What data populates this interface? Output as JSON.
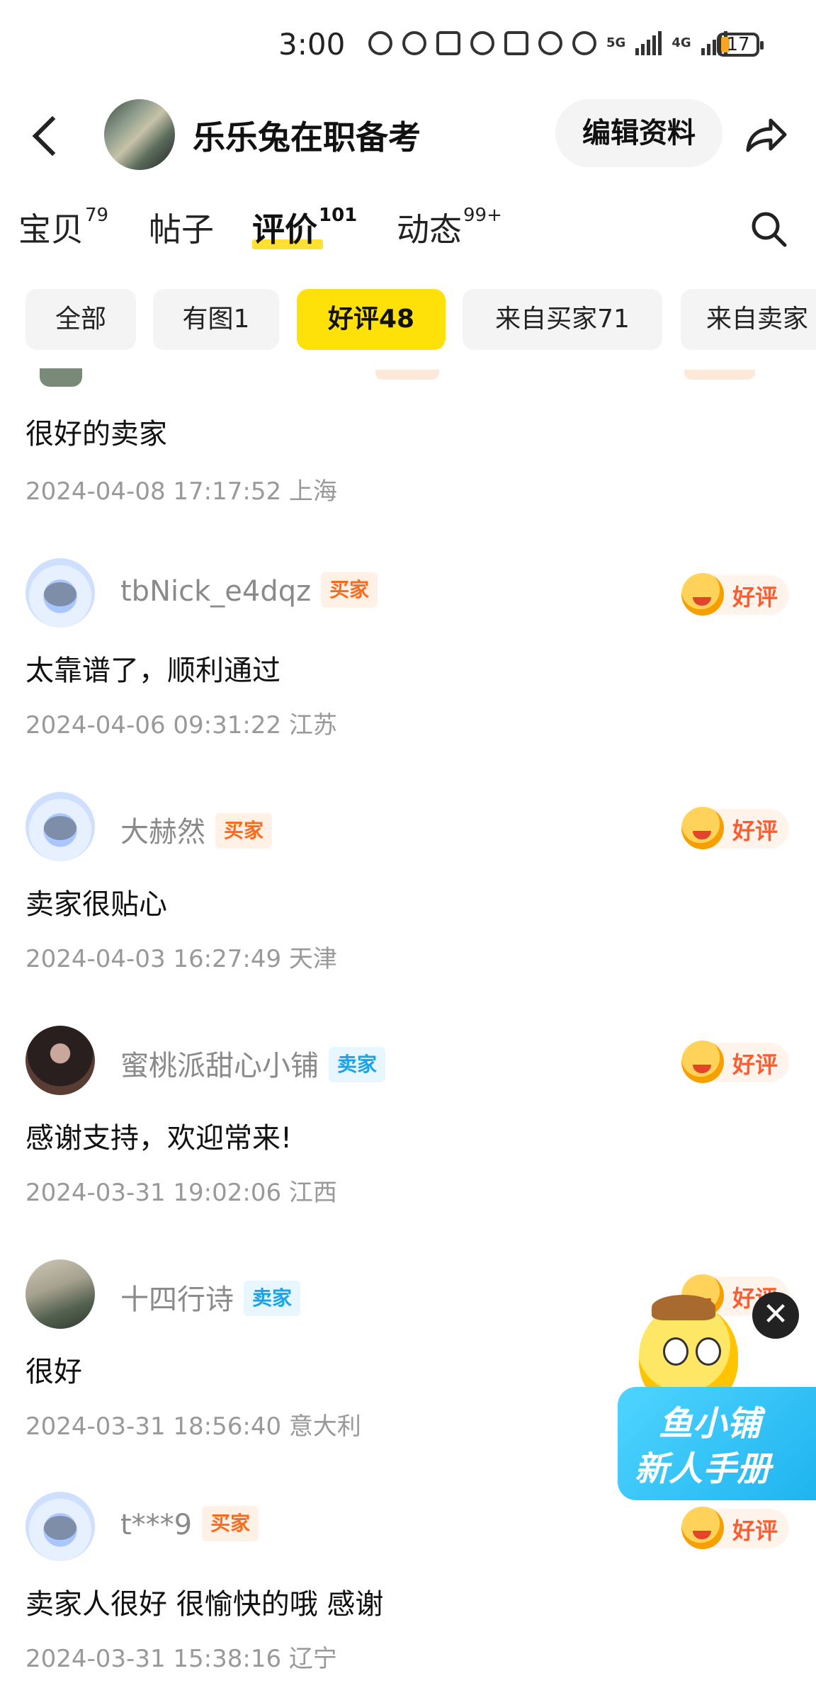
{
  "status_bar": {
    "time": "3:00",
    "network_5g": "5G",
    "network_4g": "4G",
    "battery": "17"
  },
  "header": {
    "shop_name": "乐乐兔在职备考",
    "edit_label": "编辑资料"
  },
  "tabs": [
    {
      "label": "宝贝",
      "count": "79"
    },
    {
      "label": "帖子",
      "count": ""
    },
    {
      "label": "评价",
      "count": "101"
    },
    {
      "label": "动态",
      "count": "99+"
    }
  ],
  "filters": [
    "全部",
    "有图1",
    "好评48",
    "来自买家71",
    "来自卖家"
  ],
  "top_partial_review": {
    "content": "很好的卖家",
    "meta": "2024-04-08 17:17:52 上海"
  },
  "reviews": [
    {
      "name": "tbNick_e4dqz",
      "role": "买家",
      "rating": "好评",
      "content": "太靠谱了，顺利通过",
      "meta": "2024-04-06 09:31:22 江苏"
    },
    {
      "name": "大赫然",
      "role": "买家",
      "rating": "好评",
      "content": "卖家很贴心",
      "meta": "2024-04-03 16:27:49 天津"
    },
    {
      "name": "蜜桃派甜心小铺",
      "role": "卖家",
      "rating": "好评",
      "content": "感谢支持，欢迎常来!",
      "meta": "2024-03-31 19:02:06 江西"
    },
    {
      "name": "十四行诗",
      "role": "卖家",
      "rating": "好评",
      "content": "很好",
      "meta": "2024-03-31 18:56:40 意大利"
    },
    {
      "name": "t***9",
      "role": "买家",
      "rating": "好评",
      "content": "卖家人很好 很愉快的哦 感谢",
      "meta": "2024-03-31 15:38:16 辽宁"
    }
  ],
  "promo": {
    "line1": "鱼小铺",
    "line2": "新人手册",
    "close": "✕"
  },
  "colors": {
    "accent_yellow": "#ffe10a",
    "buyer_badge": "#ff6a1a",
    "seller_badge": "#1aa3e8",
    "rating_text": "#ff5b2e"
  },
  "icons": [
    "back-arrow-icon",
    "share-icon",
    "search-icon",
    "smile-face-icon",
    "close-icon"
  ]
}
